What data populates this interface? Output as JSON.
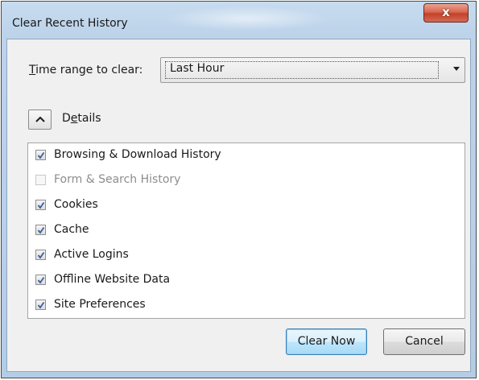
{
  "window": {
    "title": "Clear Recent History",
    "close_label": "x"
  },
  "time_range": {
    "label_accel": "T",
    "label_rest": "ime range to clear:",
    "selected": "Last Hour"
  },
  "details": {
    "label_first": "D",
    "label_accel": "e",
    "label_rest": "tails",
    "expanded": true
  },
  "items": [
    {
      "label": "Browsing & Download History",
      "checked": true,
      "enabled": true
    },
    {
      "label": "Form & Search History",
      "checked": false,
      "enabled": false
    },
    {
      "label": "Cookies",
      "checked": true,
      "enabled": true
    },
    {
      "label": "Cache",
      "checked": true,
      "enabled": true
    },
    {
      "label": "Active Logins",
      "checked": true,
      "enabled": true
    },
    {
      "label": "Offline Website Data",
      "checked": true,
      "enabled": true
    },
    {
      "label": "Site Preferences",
      "checked": true,
      "enabled": true
    }
  ],
  "buttons": {
    "clear_now": "Clear Now",
    "cancel": "Cancel"
  },
  "colors": {
    "titlebar": "#bcd3ea",
    "close_button": "#c4412a",
    "check_mark": "#3a5f9e",
    "disabled_text": "#8d8d8d"
  }
}
